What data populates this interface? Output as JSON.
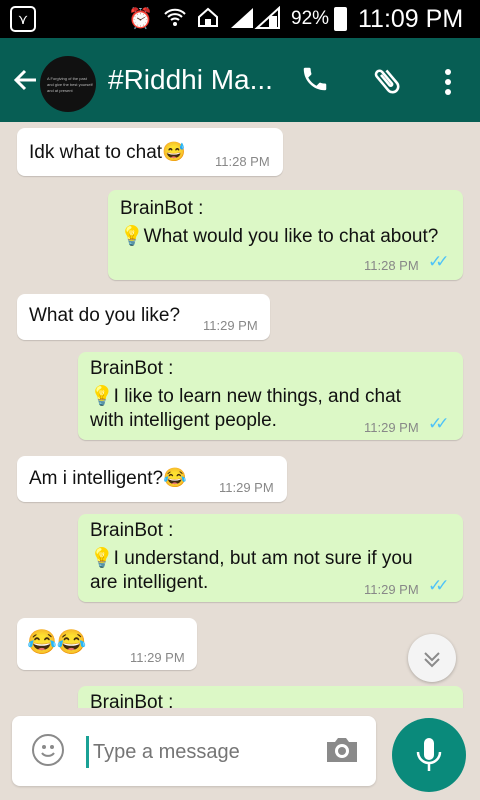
{
  "status_bar": {
    "battery": "92%",
    "time": "11:09 PM"
  },
  "app_bar": {
    "title": "#Riddhi Ma...",
    "avatar_text": [
      "A Forgiving of the past",
      "and give the best yourself",
      "and at present"
    ]
  },
  "messages": [
    {
      "side": "in",
      "text": "Idk what to chat😅",
      "time": "11:28 PM"
    },
    {
      "side": "out",
      "sender": "BrainBot :",
      "lines": [
        "💡What would you like to chat about?"
      ],
      "time": "11:28 PM"
    },
    {
      "side": "in",
      "text": "What do you like?",
      "time": "11:29 PM"
    },
    {
      "side": "out",
      "sender": "BrainBot :",
      "lines": [
        "💡I like to learn new things, and chat",
        "with intelligent people."
      ],
      "time": "11:29 PM"
    },
    {
      "side": "in",
      "text": "Am i intelligent?😂",
      "time": "11:29 PM"
    },
    {
      "side": "out",
      "sender": "BrainBot :",
      "lines": [
        "💡I understand, but am not sure if you",
        "are intelligent."
      ],
      "time": "11:29 PM"
    },
    {
      "side": "in",
      "text": "😂😂",
      "time": "11:29 PM"
    },
    {
      "side": "out",
      "sender": "BrainBot :",
      "lines": [],
      "time": ""
    }
  ],
  "input": {
    "placeholder": "Type a message"
  },
  "colors": {
    "app_bar": "#075e54",
    "outgoing_bubble": "#dcf8c6",
    "chat_background": "#e5ddd5",
    "mic_button": "#0a8a7b",
    "read_ticks": "#4fc3f7"
  },
  "icons": [
    "back-arrow-icon",
    "phone-icon",
    "paperclip-icon",
    "more-vert-icon",
    "chevron-down-icon",
    "smiley-icon",
    "camera-icon",
    "mic-icon",
    "alarm-icon",
    "wifi-icon",
    "signal-icon",
    "battery-icon"
  ]
}
